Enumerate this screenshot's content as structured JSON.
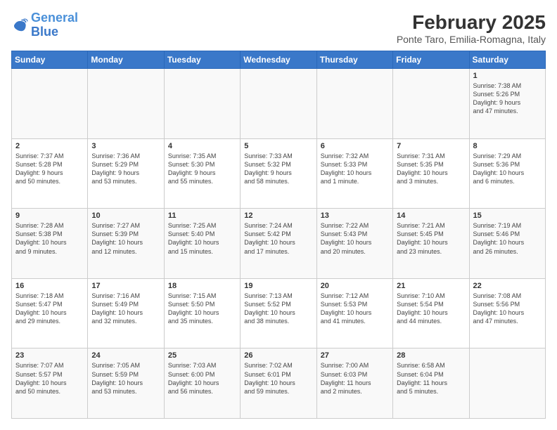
{
  "header": {
    "logo_line1": "General",
    "logo_line2": "Blue",
    "title": "February 2025",
    "subtitle": "Ponte Taro, Emilia-Romagna, Italy"
  },
  "weekdays": [
    "Sunday",
    "Monday",
    "Tuesday",
    "Wednesday",
    "Thursday",
    "Friday",
    "Saturday"
  ],
  "weeks": [
    [
      {
        "day": "",
        "info": ""
      },
      {
        "day": "",
        "info": ""
      },
      {
        "day": "",
        "info": ""
      },
      {
        "day": "",
        "info": ""
      },
      {
        "day": "",
        "info": ""
      },
      {
        "day": "",
        "info": ""
      },
      {
        "day": "1",
        "info": "Sunrise: 7:38 AM\nSunset: 5:26 PM\nDaylight: 9 hours\nand 47 minutes."
      }
    ],
    [
      {
        "day": "2",
        "info": "Sunrise: 7:37 AM\nSunset: 5:28 PM\nDaylight: 9 hours\nand 50 minutes."
      },
      {
        "day": "3",
        "info": "Sunrise: 7:36 AM\nSunset: 5:29 PM\nDaylight: 9 hours\nand 53 minutes."
      },
      {
        "day": "4",
        "info": "Sunrise: 7:35 AM\nSunset: 5:30 PM\nDaylight: 9 hours\nand 55 minutes."
      },
      {
        "day": "5",
        "info": "Sunrise: 7:33 AM\nSunset: 5:32 PM\nDaylight: 9 hours\nand 58 minutes."
      },
      {
        "day": "6",
        "info": "Sunrise: 7:32 AM\nSunset: 5:33 PM\nDaylight: 10 hours\nand 1 minute."
      },
      {
        "day": "7",
        "info": "Sunrise: 7:31 AM\nSunset: 5:35 PM\nDaylight: 10 hours\nand 3 minutes."
      },
      {
        "day": "8",
        "info": "Sunrise: 7:29 AM\nSunset: 5:36 PM\nDaylight: 10 hours\nand 6 minutes."
      }
    ],
    [
      {
        "day": "9",
        "info": "Sunrise: 7:28 AM\nSunset: 5:38 PM\nDaylight: 10 hours\nand 9 minutes."
      },
      {
        "day": "10",
        "info": "Sunrise: 7:27 AM\nSunset: 5:39 PM\nDaylight: 10 hours\nand 12 minutes."
      },
      {
        "day": "11",
        "info": "Sunrise: 7:25 AM\nSunset: 5:40 PM\nDaylight: 10 hours\nand 15 minutes."
      },
      {
        "day": "12",
        "info": "Sunrise: 7:24 AM\nSunset: 5:42 PM\nDaylight: 10 hours\nand 17 minutes."
      },
      {
        "day": "13",
        "info": "Sunrise: 7:22 AM\nSunset: 5:43 PM\nDaylight: 10 hours\nand 20 minutes."
      },
      {
        "day": "14",
        "info": "Sunrise: 7:21 AM\nSunset: 5:45 PM\nDaylight: 10 hours\nand 23 minutes."
      },
      {
        "day": "15",
        "info": "Sunrise: 7:19 AM\nSunset: 5:46 PM\nDaylight: 10 hours\nand 26 minutes."
      }
    ],
    [
      {
        "day": "16",
        "info": "Sunrise: 7:18 AM\nSunset: 5:47 PM\nDaylight: 10 hours\nand 29 minutes."
      },
      {
        "day": "17",
        "info": "Sunrise: 7:16 AM\nSunset: 5:49 PM\nDaylight: 10 hours\nand 32 minutes."
      },
      {
        "day": "18",
        "info": "Sunrise: 7:15 AM\nSunset: 5:50 PM\nDaylight: 10 hours\nand 35 minutes."
      },
      {
        "day": "19",
        "info": "Sunrise: 7:13 AM\nSunset: 5:52 PM\nDaylight: 10 hours\nand 38 minutes."
      },
      {
        "day": "20",
        "info": "Sunrise: 7:12 AM\nSunset: 5:53 PM\nDaylight: 10 hours\nand 41 minutes."
      },
      {
        "day": "21",
        "info": "Sunrise: 7:10 AM\nSunset: 5:54 PM\nDaylight: 10 hours\nand 44 minutes."
      },
      {
        "day": "22",
        "info": "Sunrise: 7:08 AM\nSunset: 5:56 PM\nDaylight: 10 hours\nand 47 minutes."
      }
    ],
    [
      {
        "day": "23",
        "info": "Sunrise: 7:07 AM\nSunset: 5:57 PM\nDaylight: 10 hours\nand 50 minutes."
      },
      {
        "day": "24",
        "info": "Sunrise: 7:05 AM\nSunset: 5:59 PM\nDaylight: 10 hours\nand 53 minutes."
      },
      {
        "day": "25",
        "info": "Sunrise: 7:03 AM\nSunset: 6:00 PM\nDaylight: 10 hours\nand 56 minutes."
      },
      {
        "day": "26",
        "info": "Sunrise: 7:02 AM\nSunset: 6:01 PM\nDaylight: 10 hours\nand 59 minutes."
      },
      {
        "day": "27",
        "info": "Sunrise: 7:00 AM\nSunset: 6:03 PM\nDaylight: 11 hours\nand 2 minutes."
      },
      {
        "day": "28",
        "info": "Sunrise: 6:58 AM\nSunset: 6:04 PM\nDaylight: 11 hours\nand 5 minutes."
      },
      {
        "day": "",
        "info": ""
      }
    ]
  ]
}
